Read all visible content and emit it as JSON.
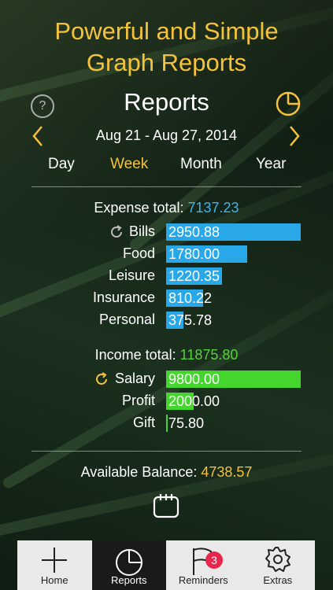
{
  "promo": {
    "line1": "Powerful and Simple",
    "line2": "Graph Reports"
  },
  "header": {
    "title": "Reports",
    "help_label": "?"
  },
  "date_range": {
    "label": "Aug 21 - Aug 27, 2014"
  },
  "periods": [
    "Day",
    "Week",
    "Month",
    "Year"
  ],
  "active_period": "Week",
  "colors": {
    "accent": "#f5c33b",
    "expense": "#28a8e8",
    "income": "#44d62c",
    "expense_total": "#3fb4ef",
    "income_total": "#55d23a",
    "badge": "#e8254a"
  },
  "expense": {
    "label": "Expense total:",
    "total": "7137.23",
    "items": [
      {
        "name": "Bills",
        "value": "2950.88",
        "fraction": 1.0,
        "recurring": true
      },
      {
        "name": "Food",
        "value": "1780.00",
        "fraction": 0.603
      },
      {
        "name": "Leisure",
        "value": "1220.35",
        "fraction": 0.414
      },
      {
        "name": "Insurance",
        "value": "810.22",
        "fraction": 0.275
      },
      {
        "name": "Personal",
        "value": "375.78",
        "fraction": 0.127
      }
    ]
  },
  "income": {
    "label": "Income total:",
    "total": "11875.80",
    "items": [
      {
        "name": "Salary",
        "value": "9800.00",
        "fraction": 1.0,
        "recurring": true
      },
      {
        "name": "Profit",
        "value": "2000.00",
        "fraction": 0.204
      },
      {
        "name": "Gift",
        "value": "75.80",
        "fraction": 0.0077
      }
    ]
  },
  "balance": {
    "label": "Available Balance:",
    "value": "4738.57"
  },
  "tabs": [
    {
      "label": "Home",
      "icon": "plus-icon"
    },
    {
      "label": "Reports",
      "icon": "pie-chart-icon"
    },
    {
      "label": "Reminders",
      "icon": "flag-icon",
      "badge": "3"
    },
    {
      "label": "Extras",
      "icon": "gear-icon"
    }
  ]
}
